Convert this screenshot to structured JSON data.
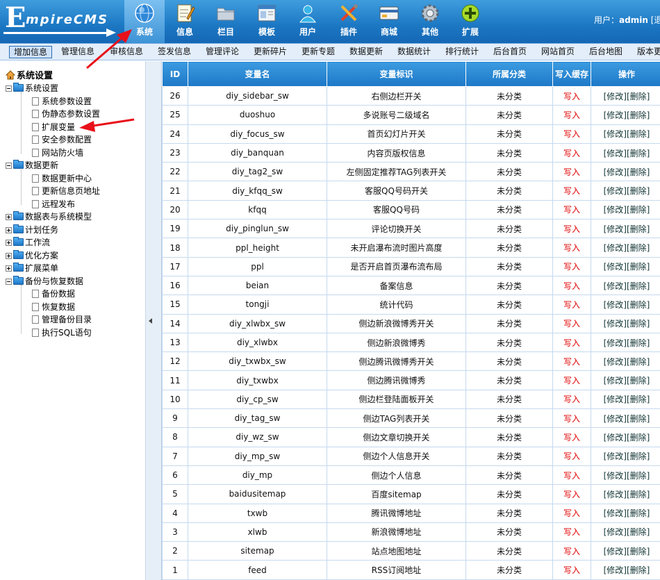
{
  "logo": {
    "first_letter": "E",
    "rest": "mpireCMS"
  },
  "nav": [
    {
      "label": "系统",
      "icon": "globe-icon"
    },
    {
      "label": "信息",
      "icon": "notepad-icon"
    },
    {
      "label": "栏目",
      "icon": "folder-icon"
    },
    {
      "label": "模板",
      "icon": "window-icon"
    },
    {
      "label": "用户",
      "icon": "user-icon"
    },
    {
      "label": "插件",
      "icon": "tools-icon"
    },
    {
      "label": "商城",
      "icon": "card-icon"
    },
    {
      "label": "其他",
      "icon": "gear-icon"
    },
    {
      "label": "扩展",
      "icon": "plus-icon"
    }
  ],
  "user": {
    "prefix": "用户：",
    "name": "admin",
    "suffix": "[退"
  },
  "toolbar": [
    "增加信息",
    "管理信息",
    "审核信息",
    "签发信息",
    "管理评论",
    "更新碎片",
    "更新专题",
    "数据更新",
    "数据统计",
    "排行统计",
    "后台首页",
    "网站首页",
    "后台地图",
    "版本更"
  ],
  "sidebar": {
    "title": "系统设置",
    "groups": [
      {
        "label": "系统设置",
        "expanded": true,
        "children": [
          "系统参数设置",
          "伪静态参数设置",
          "扩展变量",
          "安全参数配置",
          "网站防火墙"
        ]
      },
      {
        "label": "数据更新",
        "expanded": true,
        "children": [
          "数据更新中心",
          "更新信息页地址",
          "远程发布"
        ]
      },
      {
        "label": "数据表与系统模型",
        "expanded": false,
        "children": []
      },
      {
        "label": "计划任务",
        "expanded": false,
        "children": []
      },
      {
        "label": "工作流",
        "expanded": false,
        "children": []
      },
      {
        "label": "优化方案",
        "expanded": false,
        "children": []
      },
      {
        "label": "扩展菜单",
        "expanded": false,
        "children": []
      },
      {
        "label": "备份与恢复数据",
        "expanded": true,
        "children": [
          "备份数据",
          "恢复数据",
          "管理备份目录",
          "执行SQL语句"
        ]
      }
    ]
  },
  "table": {
    "headers": [
      "ID",
      "变量名",
      "变量标识",
      "所属分类",
      "写入缓存",
      "操作"
    ],
    "write_label": "写入",
    "edit_label": "[修改]",
    "delete_label": "[删除]",
    "rows": [
      {
        "id": "26",
        "name": "diy_sidebar_sw",
        "desc": "右侧边栏开关",
        "cat": "未分类"
      },
      {
        "id": "25",
        "name": "duoshuo",
        "desc": "多说账号二级域名",
        "cat": "未分类"
      },
      {
        "id": "24",
        "name": "diy_focus_sw",
        "desc": "首页幻灯片开关",
        "cat": "未分类"
      },
      {
        "id": "23",
        "name": "diy_banquan",
        "desc": "内容页版权信息",
        "cat": "未分类"
      },
      {
        "id": "22",
        "name": "diy_tag2_sw",
        "desc": "左侧固定推荐TAG列表开关",
        "cat": "未分类"
      },
      {
        "id": "21",
        "name": "diy_kfqq_sw",
        "desc": "客服QQ号码开关",
        "cat": "未分类"
      },
      {
        "id": "20",
        "name": "kfqq",
        "desc": "客服QQ号码",
        "cat": "未分类"
      },
      {
        "id": "19",
        "name": "diy_pinglun_sw",
        "desc": "评论切换开关",
        "cat": "未分类"
      },
      {
        "id": "18",
        "name": "ppl_height",
        "desc": "未开启瀑布流时图片高度",
        "cat": "未分类"
      },
      {
        "id": "17",
        "name": "ppl",
        "desc": "是否开启首页瀑布流布局",
        "cat": "未分类"
      },
      {
        "id": "16",
        "name": "beian",
        "desc": "备案信息",
        "cat": "未分类"
      },
      {
        "id": "15",
        "name": "tongji",
        "desc": "统计代码",
        "cat": "未分类"
      },
      {
        "id": "14",
        "name": "diy_xlwbx_sw",
        "desc": "侧边新浪微博秀开关",
        "cat": "未分类"
      },
      {
        "id": "13",
        "name": "diy_xlwbx",
        "desc": "侧边新浪微博秀",
        "cat": "未分类"
      },
      {
        "id": "12",
        "name": "diy_txwbx_sw",
        "desc": "侧边腾讯微博秀开关",
        "cat": "未分类"
      },
      {
        "id": "11",
        "name": "diy_txwbx",
        "desc": "侧边腾讯微博秀",
        "cat": "未分类"
      },
      {
        "id": "10",
        "name": "diy_cp_sw",
        "desc": "侧边栏登陆面板开关",
        "cat": "未分类"
      },
      {
        "id": "9",
        "name": "diy_tag_sw",
        "desc": "侧边TAG列表开关",
        "cat": "未分类"
      },
      {
        "id": "8",
        "name": "diy_wz_sw",
        "desc": "侧边文章切换开关",
        "cat": "未分类"
      },
      {
        "id": "7",
        "name": "diy_mp_sw",
        "desc": "侧边个人信息开关",
        "cat": "未分类"
      },
      {
        "id": "6",
        "name": "diy_mp",
        "desc": "侧边个人信息",
        "cat": "未分类"
      },
      {
        "id": "5",
        "name": "baidusitemap",
        "desc": "百度sitemap",
        "cat": "未分类"
      },
      {
        "id": "4",
        "name": "txwb",
        "desc": "腾讯微博地址",
        "cat": "未分类"
      },
      {
        "id": "3",
        "name": "xlwb",
        "desc": "新浪微博地址",
        "cat": "未分类"
      },
      {
        "id": "2",
        "name": "sitemap",
        "desc": "站点地图地址",
        "cat": "未分类"
      },
      {
        "id": "1",
        "name": "feed",
        "desc": "RSS订阅地址",
        "cat": "未分类"
      }
    ]
  },
  "colors": {
    "header_blue": "#1c77c3",
    "annotation_red": "#e8101a",
    "write_red": "#e00000"
  }
}
